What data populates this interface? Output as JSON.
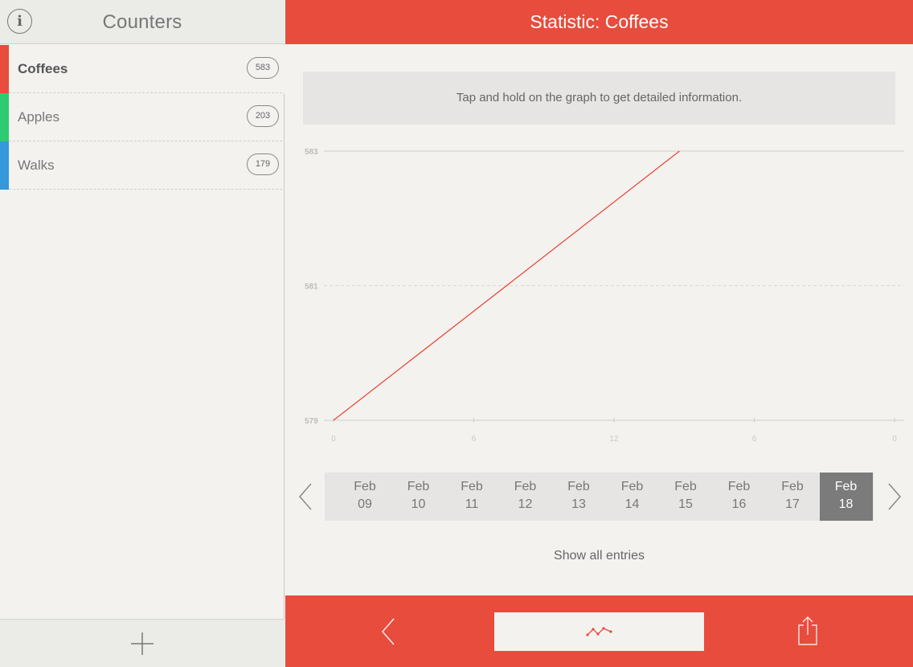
{
  "left_panel": {
    "title": "Counters",
    "info_icon": "i",
    "counters": [
      {
        "name": "Coffees",
        "count": "583",
        "color": "#e84c3d",
        "active": true
      },
      {
        "name": "Apples",
        "count": "203",
        "color": "#2ecc71",
        "active": false
      },
      {
        "name": "Walks",
        "count": "179",
        "color": "#3498db",
        "active": false
      }
    ]
  },
  "right_panel": {
    "title": "Statistic: Coffees",
    "hint": "Tap and hold on the graph to get detailed information.",
    "show_all": "Show all entries"
  },
  "chart_data": {
    "type": "line",
    "y_ticks": [
      "583",
      "581",
      "579"
    ],
    "x_ticks": [
      "0",
      "6",
      "12",
      "6",
      "0"
    ],
    "ylim": [
      579,
      583
    ],
    "series": [
      {
        "color": "#e84c3d",
        "points": [
          {
            "x": 0,
            "y": 579
          },
          {
            "x": 14.8,
            "y": 583
          }
        ]
      }
    ],
    "xlim": [
      0,
      24
    ]
  },
  "dates": [
    {
      "month": "Feb",
      "day": "09"
    },
    {
      "month": "Feb",
      "day": "10"
    },
    {
      "month": "Feb",
      "day": "11"
    },
    {
      "month": "Feb",
      "day": "12"
    },
    {
      "month": "Feb",
      "day": "13"
    },
    {
      "month": "Feb",
      "day": "14"
    },
    {
      "month": "Feb",
      "day": "15"
    },
    {
      "month": "Feb",
      "day": "16"
    },
    {
      "month": "Feb",
      "day": "17"
    },
    {
      "month": "Feb",
      "day": "18",
      "selected": true
    }
  ],
  "colors": {
    "accent": "#e84c3d",
    "selected_date": "#7b7b7b"
  }
}
